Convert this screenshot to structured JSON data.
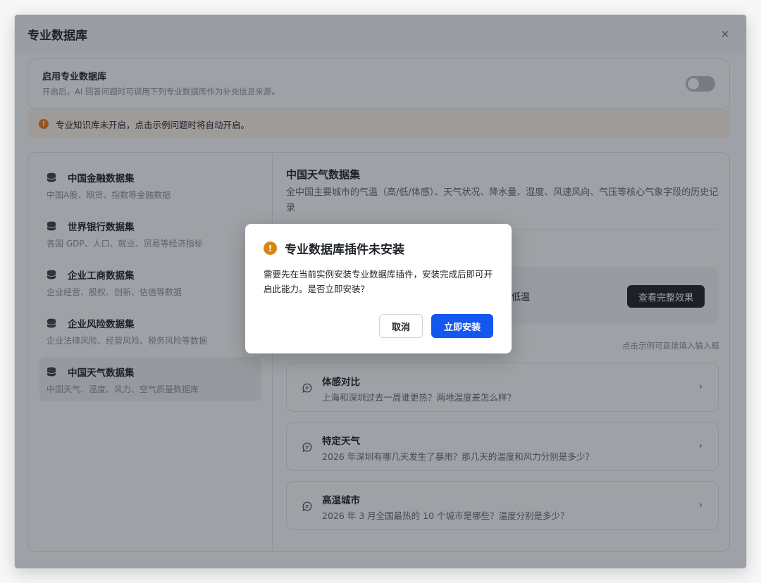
{
  "header": {
    "title": "专业数据库",
    "close_label": "×"
  },
  "enable": {
    "title": "启用专业数据库",
    "desc": "开启后，AI 回答问题时可调用下列专业数据库作为补充信息来源。",
    "toggle_on": false
  },
  "warning": {
    "icon": "!",
    "text": "专业知识库未开启，点击示例问题时将自动开启。"
  },
  "datasets": [
    {
      "name": "中国金融数据集",
      "desc": "中国A股、期货、指数等金融数据"
    },
    {
      "name": "世界银行数据集",
      "desc": "各国 GDP、人口、就业、贸易等经济指标"
    },
    {
      "name": "企业工商数据集",
      "desc": "企业经营、股权、创新、估值等数据"
    },
    {
      "name": "企业风险数据集",
      "desc": "企业法律风险、经营风险、税务风险等数据"
    },
    {
      "name": "中国天气数据集",
      "desc": "中国天气、温度、风力、空气质量数据库"
    }
  ],
  "active_index": 4,
  "detail": {
    "title": "中国天气数据集",
    "desc": "全中国主要城市的气温（高/低/体感）、天气状况、降水量、湿度、风速风向、气压等核心气象字段的历史记录",
    "preview_text": "低温",
    "view_button": "查看完整效果",
    "hint": "点击示例可直接填入输入框"
  },
  "questions": [
    {
      "title": "体感对比",
      "text": "上海和深圳过去一周谁更热？两地温度差怎么样？"
    },
    {
      "title": "特定天气",
      "text": "2026 年深圳有哪几天发生了暴雨？那几天的温度和风力分别是多少？"
    },
    {
      "title": "高温城市",
      "text": "2026 年 3 月全国最热的 10 个城市是哪些？温度分别是多少？"
    }
  ],
  "dialog": {
    "icon": "!",
    "title": "专业数据库插件未安装",
    "body": "需要先在当前实例安装专业数据库插件，安装完成后即可开启此能力。是否立即安装？",
    "cancel": "取消",
    "confirm": "立即安装"
  },
  "colors": {
    "primary": "#1456f0",
    "warning": "#f07a1a",
    "dialog_warning": "#d6860f",
    "warning_bg": "#fff4ea"
  }
}
